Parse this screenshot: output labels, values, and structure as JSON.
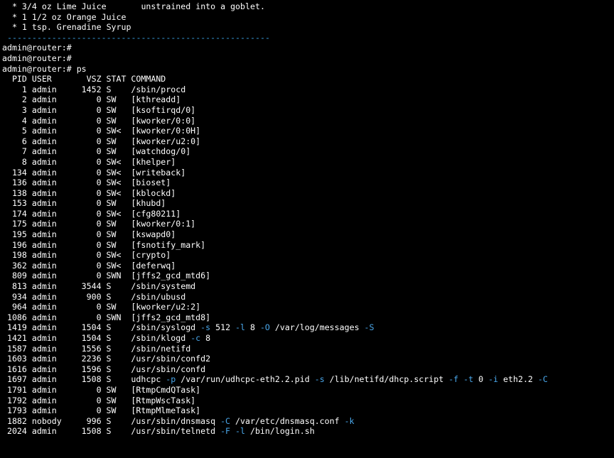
{
  "recipe_lines": [
    "  * 3/4 oz Lime Juice       unstrained into a goblet.",
    "  * 1 1/2 oz Orange Juice",
    "  * 1 tsp. Grenadine Syrup"
  ],
  "separator": " -----------------------------------------------------",
  "prompt_lines": [
    "admin@router:#",
    "admin@router:#",
    "admin@router:# ps"
  ],
  "ps_header": {
    "pid": "PID",
    "user": "USER",
    "vsz": "VSZ",
    "stat": "STAT",
    "command": "COMMAND"
  },
  "processes": [
    {
      "pid": "1",
      "user": "admin",
      "vsz": "1452",
      "stat": "S",
      "cmd": [
        [
          "/sbin/procd",
          false
        ]
      ]
    },
    {
      "pid": "2",
      "user": "admin",
      "vsz": "0",
      "stat": "SW",
      "cmd": [
        [
          "[kthreadd]",
          false
        ]
      ]
    },
    {
      "pid": "3",
      "user": "admin",
      "vsz": "0",
      "stat": "SW",
      "cmd": [
        [
          "[ksoftirqd/0]",
          false
        ]
      ]
    },
    {
      "pid": "4",
      "user": "admin",
      "vsz": "0",
      "stat": "SW",
      "cmd": [
        [
          "[kworker/0:0]",
          false
        ]
      ]
    },
    {
      "pid": "5",
      "user": "admin",
      "vsz": "0",
      "stat": "SW<",
      "cmd": [
        [
          "[kworker/0:0H]",
          false
        ]
      ]
    },
    {
      "pid": "6",
      "user": "admin",
      "vsz": "0",
      "stat": "SW",
      "cmd": [
        [
          "[kworker/u2:0]",
          false
        ]
      ]
    },
    {
      "pid": "7",
      "user": "admin",
      "vsz": "0",
      "stat": "SW",
      "cmd": [
        [
          "[watchdog/0]",
          false
        ]
      ]
    },
    {
      "pid": "8",
      "user": "admin",
      "vsz": "0",
      "stat": "SW<",
      "cmd": [
        [
          "[khelper]",
          false
        ]
      ]
    },
    {
      "pid": "134",
      "user": "admin",
      "vsz": "0",
      "stat": "SW<",
      "cmd": [
        [
          "[writeback]",
          false
        ]
      ]
    },
    {
      "pid": "136",
      "user": "admin",
      "vsz": "0",
      "stat": "SW<",
      "cmd": [
        [
          "[bioset]",
          false
        ]
      ]
    },
    {
      "pid": "138",
      "user": "admin",
      "vsz": "0",
      "stat": "SW<",
      "cmd": [
        [
          "[kblockd]",
          false
        ]
      ]
    },
    {
      "pid": "153",
      "user": "admin",
      "vsz": "0",
      "stat": "SW",
      "cmd": [
        [
          "[khubd]",
          false
        ]
      ]
    },
    {
      "pid": "174",
      "user": "admin",
      "vsz": "0",
      "stat": "SW<",
      "cmd": [
        [
          "[cfg80211]",
          false
        ]
      ]
    },
    {
      "pid": "175",
      "user": "admin",
      "vsz": "0",
      "stat": "SW",
      "cmd": [
        [
          "[kworker/0:1]",
          false
        ]
      ]
    },
    {
      "pid": "195",
      "user": "admin",
      "vsz": "0",
      "stat": "SW",
      "cmd": [
        [
          "[kswapd0]",
          false
        ]
      ]
    },
    {
      "pid": "196",
      "user": "admin",
      "vsz": "0",
      "stat": "SW",
      "cmd": [
        [
          "[fsnotify_mark]",
          false
        ]
      ]
    },
    {
      "pid": "198",
      "user": "admin",
      "vsz": "0",
      "stat": "SW<",
      "cmd": [
        [
          "[crypto]",
          false
        ]
      ]
    },
    {
      "pid": "362",
      "user": "admin",
      "vsz": "0",
      "stat": "SW<",
      "cmd": [
        [
          "[deferwq]",
          false
        ]
      ]
    },
    {
      "pid": "809",
      "user": "admin",
      "vsz": "0",
      "stat": "SWN",
      "cmd": [
        [
          "[jffs2_gcd_mtd6]",
          false
        ]
      ]
    },
    {
      "pid": "813",
      "user": "admin",
      "vsz": "3544",
      "stat": "S",
      "cmd": [
        [
          "/sbin/systemd",
          false
        ]
      ]
    },
    {
      "pid": "934",
      "user": "admin",
      "vsz": "900",
      "stat": "S",
      "cmd": [
        [
          "/sbin/ubusd",
          false
        ]
      ]
    },
    {
      "pid": "964",
      "user": "admin",
      "vsz": "0",
      "stat": "SW",
      "cmd": [
        [
          "[kworker/u2:2]",
          false
        ]
      ]
    },
    {
      "pid": "1086",
      "user": "admin",
      "vsz": "0",
      "stat": "SWN",
      "cmd": [
        [
          "[jffs2_gcd_mtd8]",
          false
        ]
      ]
    },
    {
      "pid": "1419",
      "user": "admin",
      "vsz": "1504",
      "stat": "S",
      "cmd": [
        [
          "/sbin/syslogd ",
          false
        ],
        [
          "-s",
          true
        ],
        [
          " 512 ",
          false
        ],
        [
          "-l",
          true
        ],
        [
          " 8 ",
          false
        ],
        [
          "-O",
          true
        ],
        [
          " /var/log/messages ",
          false
        ],
        [
          "-S",
          true
        ]
      ]
    },
    {
      "pid": "1421",
      "user": "admin",
      "vsz": "1504",
      "stat": "S",
      "cmd": [
        [
          "/sbin/klogd ",
          false
        ],
        [
          "-c",
          true
        ],
        [
          " 8",
          false
        ]
      ]
    },
    {
      "pid": "1587",
      "user": "admin",
      "vsz": "1556",
      "stat": "S",
      "cmd": [
        [
          "/sbin/netifd",
          false
        ]
      ]
    },
    {
      "pid": "1603",
      "user": "admin",
      "vsz": "2236",
      "stat": "S",
      "cmd": [
        [
          "/usr/sbin/confd2",
          false
        ]
      ]
    },
    {
      "pid": "1616",
      "user": "admin",
      "vsz": "1596",
      "stat": "S",
      "cmd": [
        [
          "/usr/sbin/confd",
          false
        ]
      ]
    },
    {
      "pid": "1697",
      "user": "admin",
      "vsz": "1508",
      "stat": "S",
      "cmd": [
        [
          "udhcpc ",
          false
        ],
        [
          "-p",
          true
        ],
        [
          " /var/run/udhcpc-eth2.2.pid ",
          false
        ],
        [
          "-s",
          true
        ],
        [
          " /lib/netifd/dhcp.script ",
          false
        ],
        [
          "-f",
          true
        ],
        [
          " ",
          false
        ],
        [
          "-t",
          true
        ],
        [
          " 0 ",
          false
        ],
        [
          "-i",
          true
        ],
        [
          " eth2.2 ",
          false
        ],
        [
          "-C",
          true
        ]
      ]
    },
    {
      "pid": "1791",
      "user": "admin",
      "vsz": "0",
      "stat": "SW",
      "cmd": [
        [
          "[RtmpCmdQTask]",
          false
        ]
      ]
    },
    {
      "pid": "1792",
      "user": "admin",
      "vsz": "0",
      "stat": "SW",
      "cmd": [
        [
          "[RtmpWscTask]",
          false
        ]
      ]
    },
    {
      "pid": "1793",
      "user": "admin",
      "vsz": "0",
      "stat": "SW",
      "cmd": [
        [
          "[RtmpMlmeTask]",
          false
        ]
      ]
    },
    {
      "pid": "1882",
      "user": "nobody",
      "vsz": "996",
      "stat": "S",
      "cmd": [
        [
          "/usr/sbin/dnsmasq ",
          false
        ],
        [
          "-C",
          true
        ],
        [
          " /var/etc/dnsmasq.conf ",
          false
        ],
        [
          "-k",
          true
        ]
      ]
    },
    {
      "pid": "2024",
      "user": "admin",
      "vsz": "1508",
      "stat": "S",
      "cmd": [
        [
          "/usr/sbin/telnetd ",
          false
        ],
        [
          "-F",
          true
        ],
        [
          " ",
          false
        ],
        [
          "-l",
          true
        ],
        [
          " /bin/login.sh",
          false
        ]
      ]
    }
  ],
  "colors": {
    "background": "#000000",
    "text": "#ffffff",
    "option_flag": "#4aa8ec",
    "separator": "#3aa0e0"
  }
}
